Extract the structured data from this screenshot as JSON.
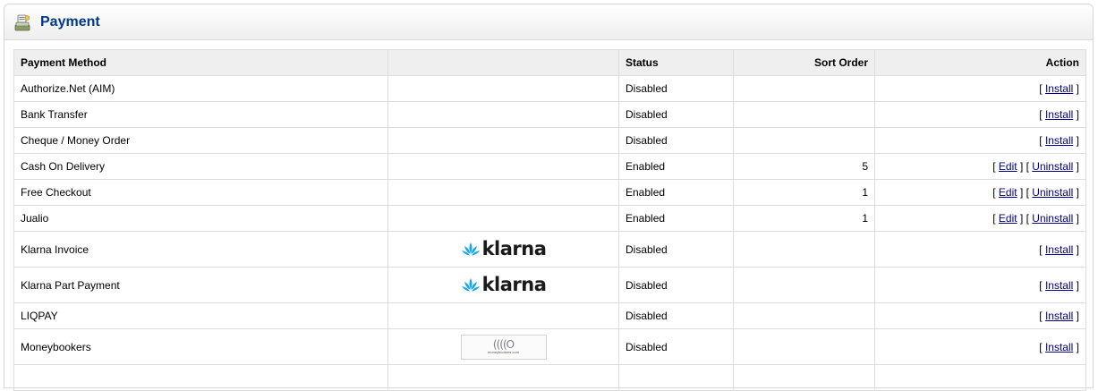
{
  "panel": {
    "title": "Payment",
    "icon": "payment-icon"
  },
  "table": {
    "headers": {
      "method": "Payment Method",
      "logo": "",
      "status": "Status",
      "sort_order": "Sort Order",
      "action": "Action"
    },
    "rows": [
      {
        "name": "Authorize.Net (AIM)",
        "logo": "",
        "status": "Disabled",
        "sort_order": "",
        "actions": [
          "Install"
        ]
      },
      {
        "name": "Bank Transfer",
        "logo": "",
        "status": "Disabled",
        "sort_order": "",
        "actions": [
          "Install"
        ]
      },
      {
        "name": "Cheque / Money Order",
        "logo": "",
        "status": "Disabled",
        "sort_order": "",
        "actions": [
          "Install"
        ]
      },
      {
        "name": "Cash On Delivery",
        "logo": "",
        "status": "Enabled",
        "sort_order": "5",
        "actions": [
          "Edit",
          "Uninstall"
        ]
      },
      {
        "name": "Free Checkout",
        "logo": "",
        "status": "Enabled",
        "sort_order": "1",
        "actions": [
          "Edit",
          "Uninstall"
        ]
      },
      {
        "name": "Jualio",
        "logo": "",
        "status": "Enabled",
        "sort_order": "1",
        "actions": [
          "Edit",
          "Uninstall"
        ]
      },
      {
        "name": "Klarna Invoice",
        "logo": "klarna",
        "logo_text": "klarna",
        "status": "Disabled",
        "sort_order": "",
        "actions": [
          "Install"
        ]
      },
      {
        "name": "Klarna Part Payment",
        "logo": "klarna",
        "logo_text": "klarna",
        "status": "Disabled",
        "sort_order": "",
        "actions": [
          "Install"
        ]
      },
      {
        "name": "LIQPAY",
        "logo": "",
        "status": "Disabled",
        "sort_order": "",
        "actions": [
          "Install"
        ]
      },
      {
        "name": "Moneybookers",
        "logo": "moneybookers",
        "logo_text": "moneybookers.com",
        "status": "Disabled",
        "sort_order": "",
        "actions": [
          "Install"
        ]
      },
      {
        "name": "",
        "logo": "",
        "status": "",
        "sort_order": "",
        "actions": []
      }
    ]
  },
  "colors": {
    "title": "#003a88",
    "link": "#000080",
    "klarna_icon": "#17a8e3",
    "border": "#dddddd",
    "header_bg": "#efefef"
  }
}
